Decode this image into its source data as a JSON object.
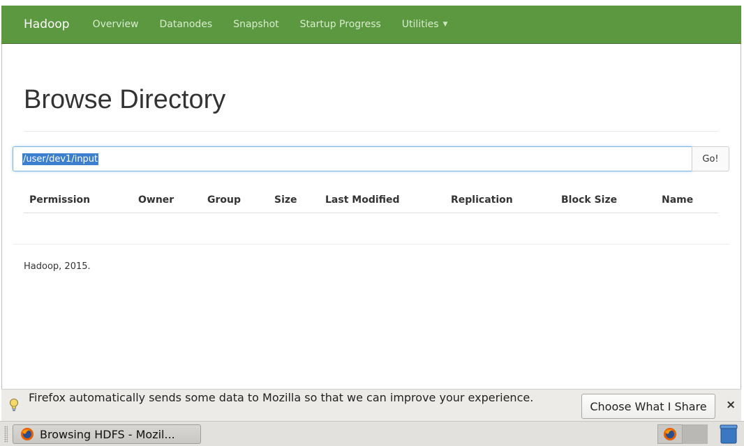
{
  "navbar": {
    "brand": "Hadoop",
    "items": [
      {
        "label": "Overview"
      },
      {
        "label": "Datanodes"
      },
      {
        "label": "Snapshot"
      },
      {
        "label": "Startup Progress"
      },
      {
        "label": "Utilities"
      }
    ]
  },
  "main": {
    "title": "Browse Directory",
    "path_value": "/user/dev1/input",
    "go_label": "Go!",
    "columns": [
      "Permission",
      "Owner",
      "Group",
      "Size",
      "Last Modified",
      "Replication",
      "Block Size",
      "Name"
    ],
    "footer": "Hadoop, 2015."
  },
  "notification": {
    "text": "Firefox automatically sends some data to Mozilla so that we can improve your experience.",
    "button_label": "Choose What I Share",
    "close_label": "×"
  },
  "taskbar": {
    "window_label": "Browsing HDFS - Mozil..."
  },
  "colors": {
    "navbar": "#5b983f",
    "selection": "#3d7fcf"
  }
}
